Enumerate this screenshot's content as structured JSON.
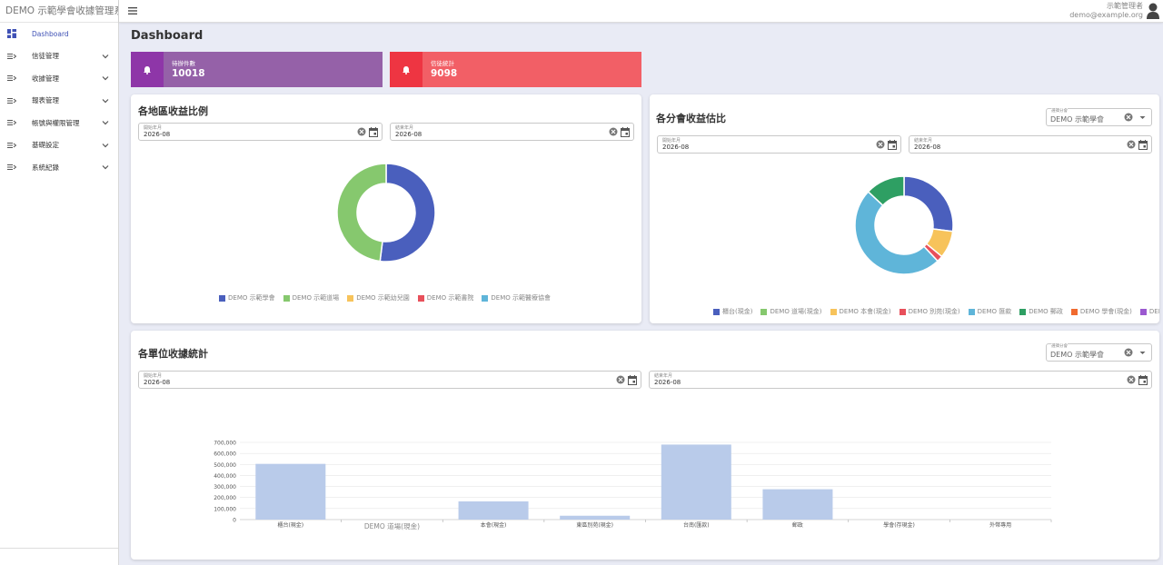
{
  "app": {
    "title": "DEMO 示範學會收據管理系統"
  },
  "sidebar": {
    "items": [
      {
        "label": "Dashboard",
        "icon": "dashboard-icon"
      },
      {
        "label": "信徒管理",
        "icon": "list-icon"
      },
      {
        "label": "收據管理",
        "icon": "list-icon"
      },
      {
        "label": "報表管理",
        "icon": "list-icon"
      },
      {
        "label": "帳號與權限管理",
        "icon": "list-icon"
      },
      {
        "label": "基礎設定",
        "icon": "list-icon"
      },
      {
        "label": "系統紀錄",
        "icon": "list-icon"
      }
    ]
  },
  "header": {
    "user_name": "示範管理者",
    "user_email": "demo@example.org"
  },
  "page": {
    "title": "Dashboard"
  },
  "stats": [
    {
      "label": "待辦件數",
      "value": "10018",
      "icon": "bell-icon"
    },
    {
      "label": "信徒統計",
      "value": "9098",
      "icon": "bell-icon"
    }
  ],
  "region_card": {
    "title": "各地區收益比例",
    "start": {
      "label": "開始年月",
      "value": "2026-08"
    },
    "end": {
      "label": "結束年月",
      "value": "2026-08"
    }
  },
  "branch_card": {
    "title": "各分會收益估比",
    "select": {
      "label": "選擇分會",
      "value": "DEMO 示範學會"
    },
    "start": {
      "label": "開始年月",
      "value": "2026-08"
    },
    "end": {
      "label": "結束年月",
      "value": "2026-08"
    }
  },
  "unit_card": {
    "title": "各單位收據統計",
    "select": {
      "label": "選擇分會",
      "value": "DEMO 示範學會"
    },
    "start": {
      "label": "開始年月",
      "value": "2026-08"
    },
    "end": {
      "label": "結束年月",
      "value": "2026-08"
    }
  },
  "colors": {
    "indigo": "#4a5fbd",
    "green": "#86c86e",
    "amber": "#f7c35b",
    "red": "#e8505b",
    "sky": "#5fb5d9",
    "teal": "#2e9f63",
    "orange": "#f06a2f",
    "purple": "#9b59d0",
    "bar": "#b9cbea"
  },
  "chart_data": [
    {
      "type": "pie",
      "categories": [
        "DEMO 示範學會",
        "DEMO 示範道場",
        "DEMO 示範幼兒園",
        "DEMO 示範書院",
        "DEMO 示範醫療協會"
      ],
      "values": [
        52,
        48,
        0,
        0,
        0
      ],
      "colors": [
        "#4a5fbd",
        "#86c86e",
        "#f7c35b",
        "#e8505b",
        "#5fb5d9"
      ],
      "legend": "bottom"
    },
    {
      "type": "pie",
      "categories": [
        "櫃台(現金)",
        "DEMO 道場(現金)",
        "DEMO 本會(現金)",
        "DEMO 別苑(現金)",
        "DEMO 匯款",
        "DEMO 郵政",
        "DEMO 學會(現金)",
        "DEMO"
      ],
      "values": [
        27,
        0,
        9,
        2,
        49,
        13,
        0,
        0
      ],
      "colors": [
        "#4a5fbd",
        "#86c86e",
        "#f7c35b",
        "#e8505b",
        "#5fb5d9",
        "#2e9f63",
        "#f06a2f",
        "#9b59d0"
      ],
      "legend": "bottom"
    },
    {
      "type": "bar",
      "categories": [
        "櫃台(現金)",
        "DEMO 道場(現金)",
        "本會(現金)",
        "東區別苑(現金)",
        "台南(匯款)",
        "郵政",
        "學會(存現金)",
        "外幣專用"
      ],
      "values": [
        505000,
        0,
        165000,
        35000,
        680000,
        275000,
        0,
        0
      ],
      "ylim": [
        0,
        700000
      ],
      "yticks": [
        "0",
        "100,000",
        "200,000",
        "300,000",
        "400,000",
        "500,000",
        "600,000",
        "700,000"
      ],
      "grid": true
    }
  ]
}
